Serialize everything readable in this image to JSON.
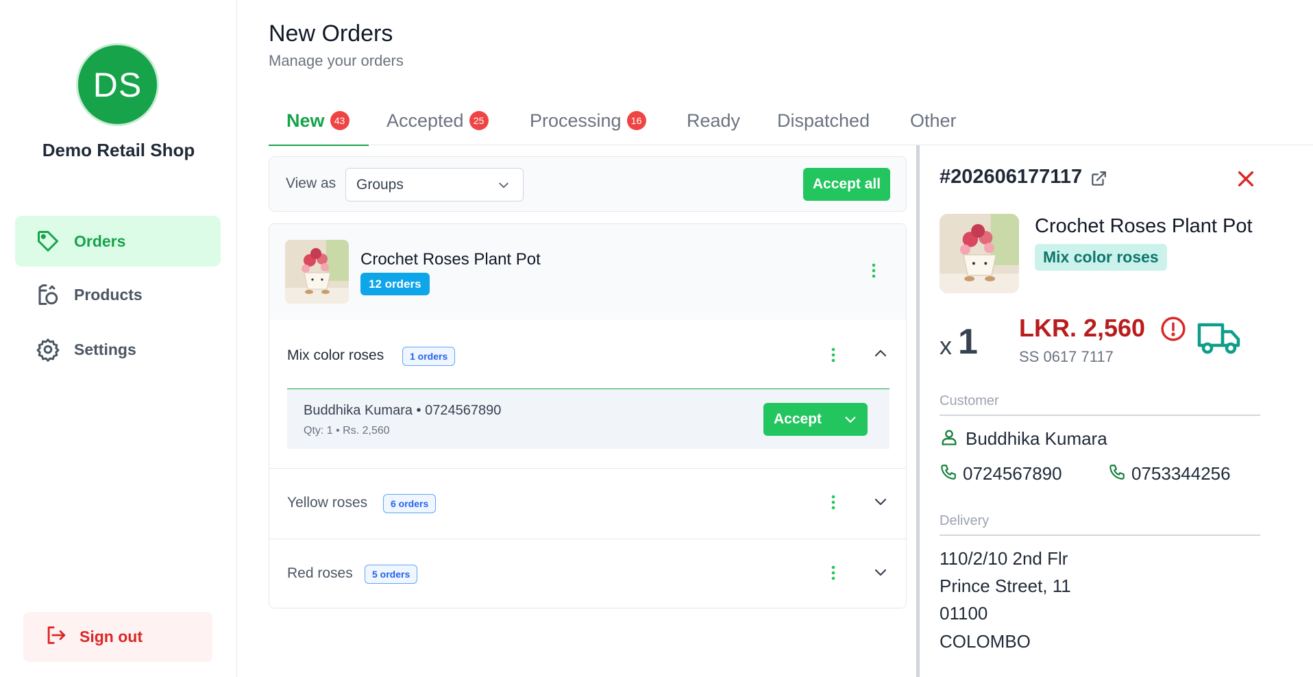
{
  "sidebar": {
    "avatar_initials": "DS",
    "shop_name": "Demo Retail Shop",
    "items": [
      {
        "label": "Orders",
        "icon": "tag-icon",
        "active": true
      },
      {
        "label": "Products",
        "icon": "products-icon",
        "active": false
      },
      {
        "label": "Settings",
        "icon": "gear-icon",
        "active": false
      }
    ],
    "sign_out": "Sign out"
  },
  "header": {
    "title": "New Orders",
    "subtitle": "Manage your orders"
  },
  "tabs": [
    {
      "label": "New",
      "badge": "43",
      "active": true
    },
    {
      "label": "Accepted",
      "badge": "25",
      "active": false
    },
    {
      "label": "Processing",
      "badge": "16",
      "active": false
    },
    {
      "label": "Ready",
      "badge": "",
      "active": false
    },
    {
      "label": "Dispatched",
      "badge": "",
      "active": false
    },
    {
      "label": "Other",
      "badge": "",
      "active": false
    }
  ],
  "view_bar": {
    "label": "View as",
    "selected": "Groups",
    "accept_all": "Accept all"
  },
  "group": {
    "product": "Crochet Roses Plant Pot",
    "count": "12 orders",
    "variants": [
      {
        "name": "Mix color roses",
        "count": "1 orders",
        "expanded": true,
        "orders": [
          {
            "customer": "Buddhika Kumara • 0724567890",
            "details": "Qty: 1 • Rs. 2,560",
            "action": "Accept"
          }
        ]
      },
      {
        "name": "Yellow roses",
        "count": "6 orders",
        "expanded": false
      },
      {
        "name": "Red roses",
        "count": "5 orders",
        "expanded": false
      }
    ]
  },
  "detail": {
    "order_id": "#202606177117",
    "product": "Crochet Roses Plant Pot",
    "variant": "Mix color roses",
    "qty_prefix": "x",
    "qty": "1",
    "price": "LKR. 2,560",
    "reference": "SS 0617 7117",
    "customer_label": "Customer",
    "customer_name": "Buddhika Kumara",
    "phone_1": "0724567890",
    "phone_2": "0753344256",
    "delivery_label": "Delivery",
    "address": [
      "110/2/10 2nd Flr",
      "Prince Street, 11",
      "01100",
      "COLOMBO"
    ]
  },
  "colors": {
    "brand_green": "#16a34a",
    "accent_green": "#22c55e",
    "badge_red": "#ef4444",
    "price_red": "#b91c1c",
    "pill_blue": "#0ea5e9",
    "teal": "#0f766e"
  }
}
